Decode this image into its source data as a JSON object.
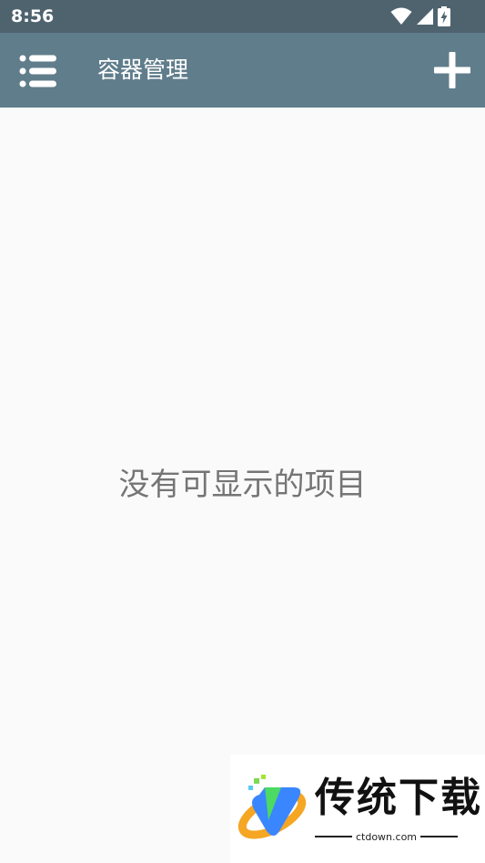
{
  "status_bar": {
    "time": "8:56",
    "icons": [
      "wifi-icon",
      "signal-icon",
      "battery-charging-icon"
    ]
  },
  "app_bar": {
    "title": "容器管理",
    "menu_icon": "list-menu-icon",
    "add_icon": "plus-icon",
    "color": "#607d8b",
    "status_color": "#4f636f"
  },
  "content": {
    "empty_message": "没有可显示的项目"
  },
  "watermark": {
    "title": "传统下载",
    "url": "ctdown.com"
  }
}
